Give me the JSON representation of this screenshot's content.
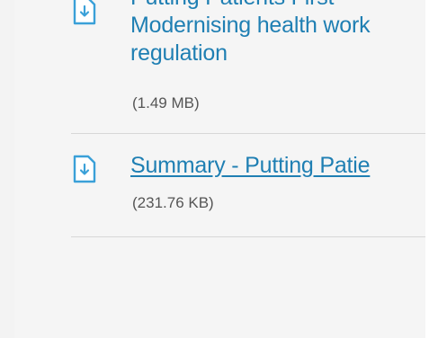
{
  "attachments": [
    {
      "title_lines": [
        "Putting Patients First -",
        "Modernising health work",
        "regulation"
      ],
      "size": "(1.49 MB)",
      "icon": "download-document-icon"
    },
    {
      "title_lines": [
        "Summary - Putting Patie"
      ],
      "size": "(231.76 KB)",
      "icon": "download-document-icon"
    }
  ],
  "colors": {
    "link": "#1f7fb3",
    "icon": "#3aa0d8",
    "text_muted": "#555555",
    "divider": "#d7d7d7",
    "background": "#f5f5f5"
  }
}
